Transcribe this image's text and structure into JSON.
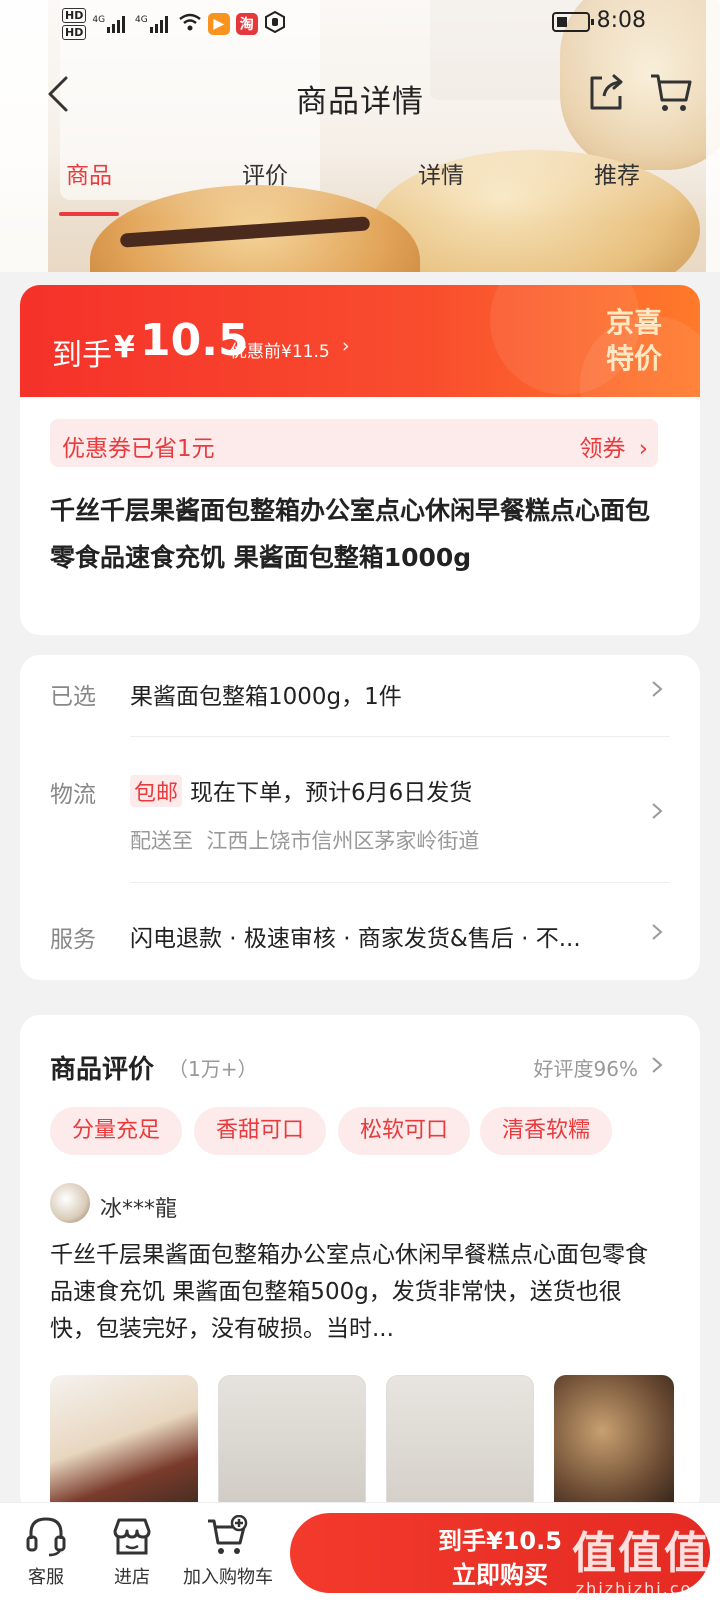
{
  "status_bar": {
    "hd1": "HD",
    "hd2": "HD",
    "net1": "4G",
    "net2": "4G",
    "taobao_icon": "淘",
    "time": "8:08"
  },
  "nav": {
    "title": "商品详情"
  },
  "tabs": [
    {
      "label": "商品",
      "active": true
    },
    {
      "label": "评价",
      "active": false
    },
    {
      "label": "详情",
      "active": false
    },
    {
      "label": "推荐",
      "active": false
    }
  ],
  "price": {
    "label": "到手",
    "currency": "¥",
    "amount": "10.5",
    "original": "优惠前¥11.5",
    "brand_line1": "京喜",
    "brand_line2": "特价"
  },
  "coupon": {
    "text": "优惠券已省1元",
    "action": "领券"
  },
  "product": {
    "title": "千丝千层果酱面包整箱办公室点心休闲早餐糕点心面包零食品速食充饥 果酱面包整箱1000g"
  },
  "specs": {
    "selected_label": "已选",
    "selected_value": "果酱面包整箱1000g，1件",
    "logistics_label": "物流",
    "free_shipping": "包邮",
    "logistics_value": "现在下单，预计6月6日发货",
    "ship_to_label": "配送至",
    "ship_to_value": "江西上饶市信州区茅家岭街道",
    "service_label": "服务",
    "service_value": "闪电退款 · 极速审核 · 商家发货&售后 · 不..."
  },
  "reviews": {
    "title": "商品评价",
    "count": "（1万+）",
    "rating": "好评度96%",
    "tags": [
      "分量充足",
      "香甜可口",
      "松软可口",
      "清香软糯"
    ],
    "reviewer": "冰***龍",
    "text": "千丝千层果酱面包整箱办公室点心休闲早餐糕点心面包零食品速食充饥 果酱面包整箱500g，发货非常快，送货也很快，包装完好，没有破损。当时..."
  },
  "bottom": {
    "service": "客服",
    "store": "进店",
    "add_cart": "加入购物车",
    "buy_price": "到手¥10.5",
    "buy_label": "立即购买",
    "watermark_big": "值值值",
    "watermark_small": "zhizhizhi.com"
  },
  "colors": {
    "accent": "#e93b3d",
    "banner_start": "#f5312a",
    "banner_end": "#ff7a2a",
    "brand_text": "#ffe9c4"
  }
}
